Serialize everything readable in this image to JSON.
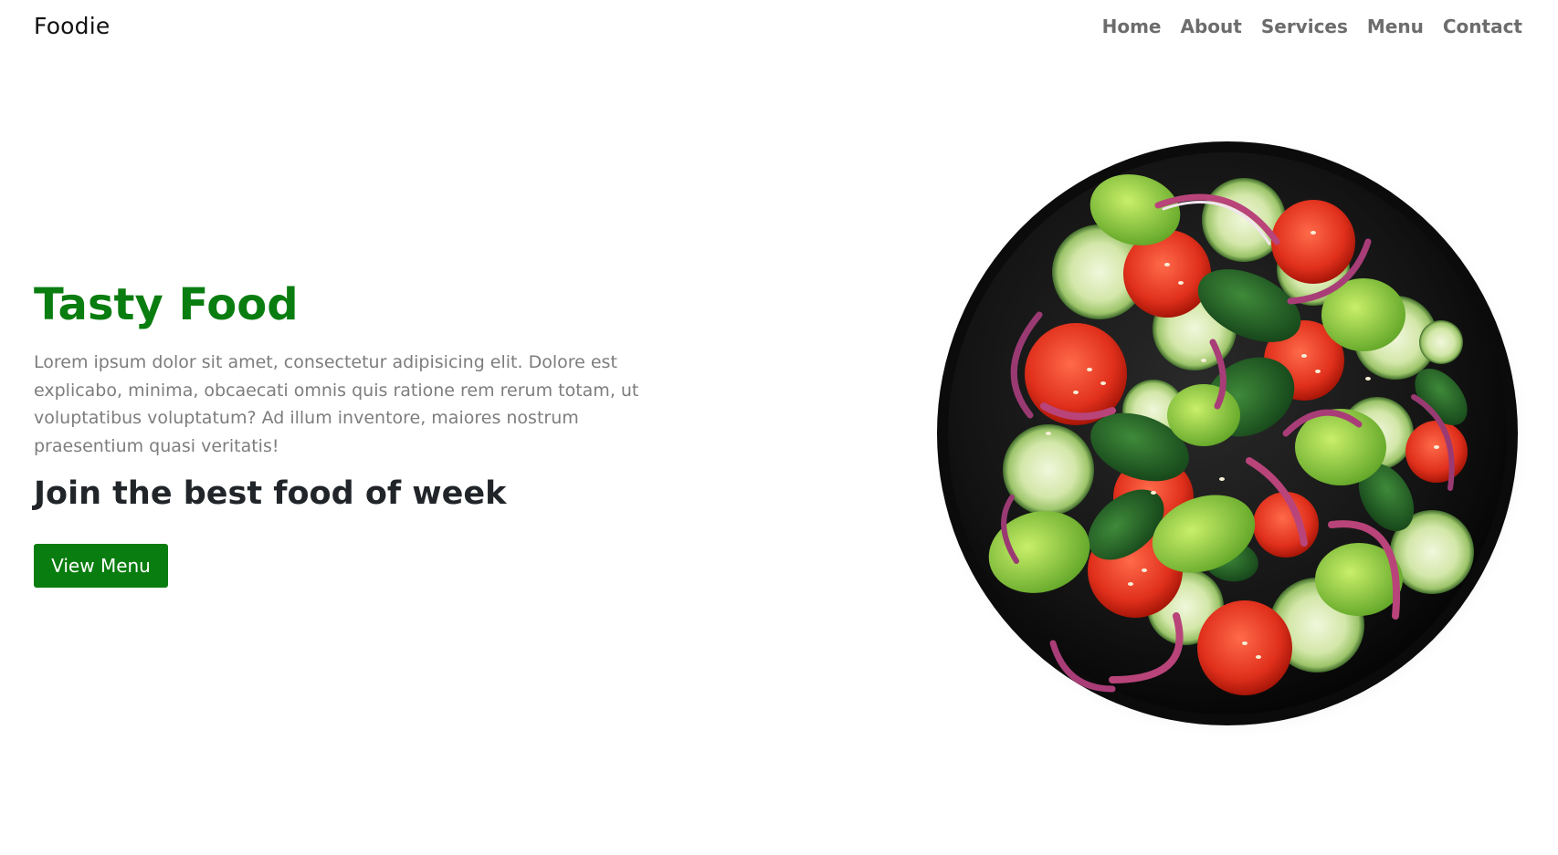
{
  "navbar": {
    "brand": "Foodie",
    "links": [
      {
        "label": "Home"
      },
      {
        "label": "About"
      },
      {
        "label": "Services"
      },
      {
        "label": "Menu"
      },
      {
        "label": "Contact"
      }
    ]
  },
  "hero": {
    "title": "Tasty Food",
    "description": "Lorem ipsum dolor sit amet, consectetur adipisicing elit. Dolore est explicabo, minima, obcaecati omnis quis ratione rem rerum totam, ut voluptatibus voluptatum? Ad illum inventore, maiores nostrum praesentium quasi veritatis!",
    "subtitle": "Join the best food of week",
    "button_label": "View Menu"
  },
  "colors": {
    "accent": "#0a7d10",
    "nav_text": "#6c6c6c",
    "body_text": "#7d7d7d",
    "heading_text": "#212529"
  },
  "image": {
    "icon": "salad-bowl-icon"
  }
}
